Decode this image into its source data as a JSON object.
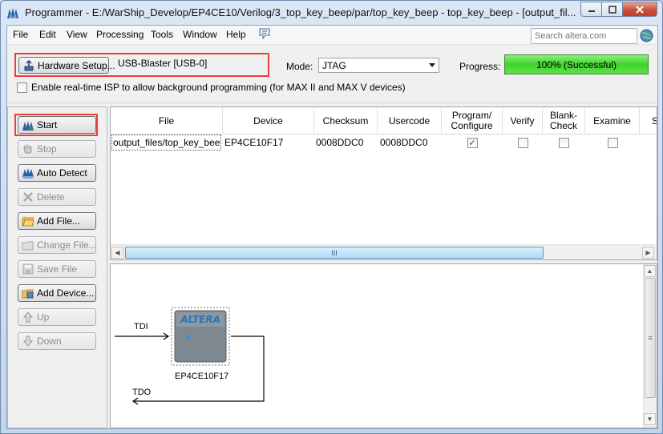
{
  "window": {
    "title": "Programmer - E:/WarShip_Develop/EP4CE10/Verilog/3_top_key_beep/par/top_key_beep - top_key_beep - [output_fil..."
  },
  "menu": {
    "items": [
      {
        "label": "File"
      },
      {
        "label": "Edit"
      },
      {
        "label": "View"
      },
      {
        "label": "Processing"
      },
      {
        "label": "Tools"
      },
      {
        "label": "Window"
      },
      {
        "label": "Help"
      }
    ],
    "search_placeholder": "Search altera.com"
  },
  "hardware": {
    "setup_label": "Hardware Setup...",
    "value": "USB-Blaster [USB-0]"
  },
  "mode": {
    "label": "Mode:",
    "value": "JTAG"
  },
  "progress": {
    "label": "Progress:",
    "text": "100% (Successful)",
    "percent": 100,
    "color": "#3fd22c"
  },
  "isp": {
    "label": "Enable real-time ISP to allow background programming (for MAX II and MAX V devices)",
    "checked": false
  },
  "buttons": {
    "start": "Start",
    "stop": "Stop",
    "auto_detect": "Auto Detect",
    "delete": "Delete",
    "add_file": "Add File...",
    "change_file": "Change File...",
    "save_file": "Save File",
    "add_device": "Add Device...",
    "up": "Up",
    "down": "Down"
  },
  "table": {
    "headers": {
      "file": "File",
      "device": "Device",
      "checksum": "Checksum",
      "usercode": "Usercode",
      "program": "Program/\nConfigure",
      "verify": "Verify",
      "blank": "Blank-\nCheck",
      "examine": "Examine",
      "security": "S"
    },
    "rows": [
      {
        "file": "output_files/top_key_bee...",
        "device": "EP4CE10F17",
        "checksum": "0008DDC0",
        "usercode": "0008DDC0",
        "program": true,
        "verify": false,
        "blank": false,
        "examine": false
      }
    ],
    "hscroll_grip": "III"
  },
  "chain": {
    "tdi": "TDI",
    "tdo": "TDO",
    "device": "EP4CE10F17",
    "chip_logo": "ALTERA",
    "vscroll_grip": "≡"
  },
  "colors": {
    "highlight": "#e8403b",
    "chip_face": "#7e8890",
    "chip_logo": "#2b74b8"
  }
}
